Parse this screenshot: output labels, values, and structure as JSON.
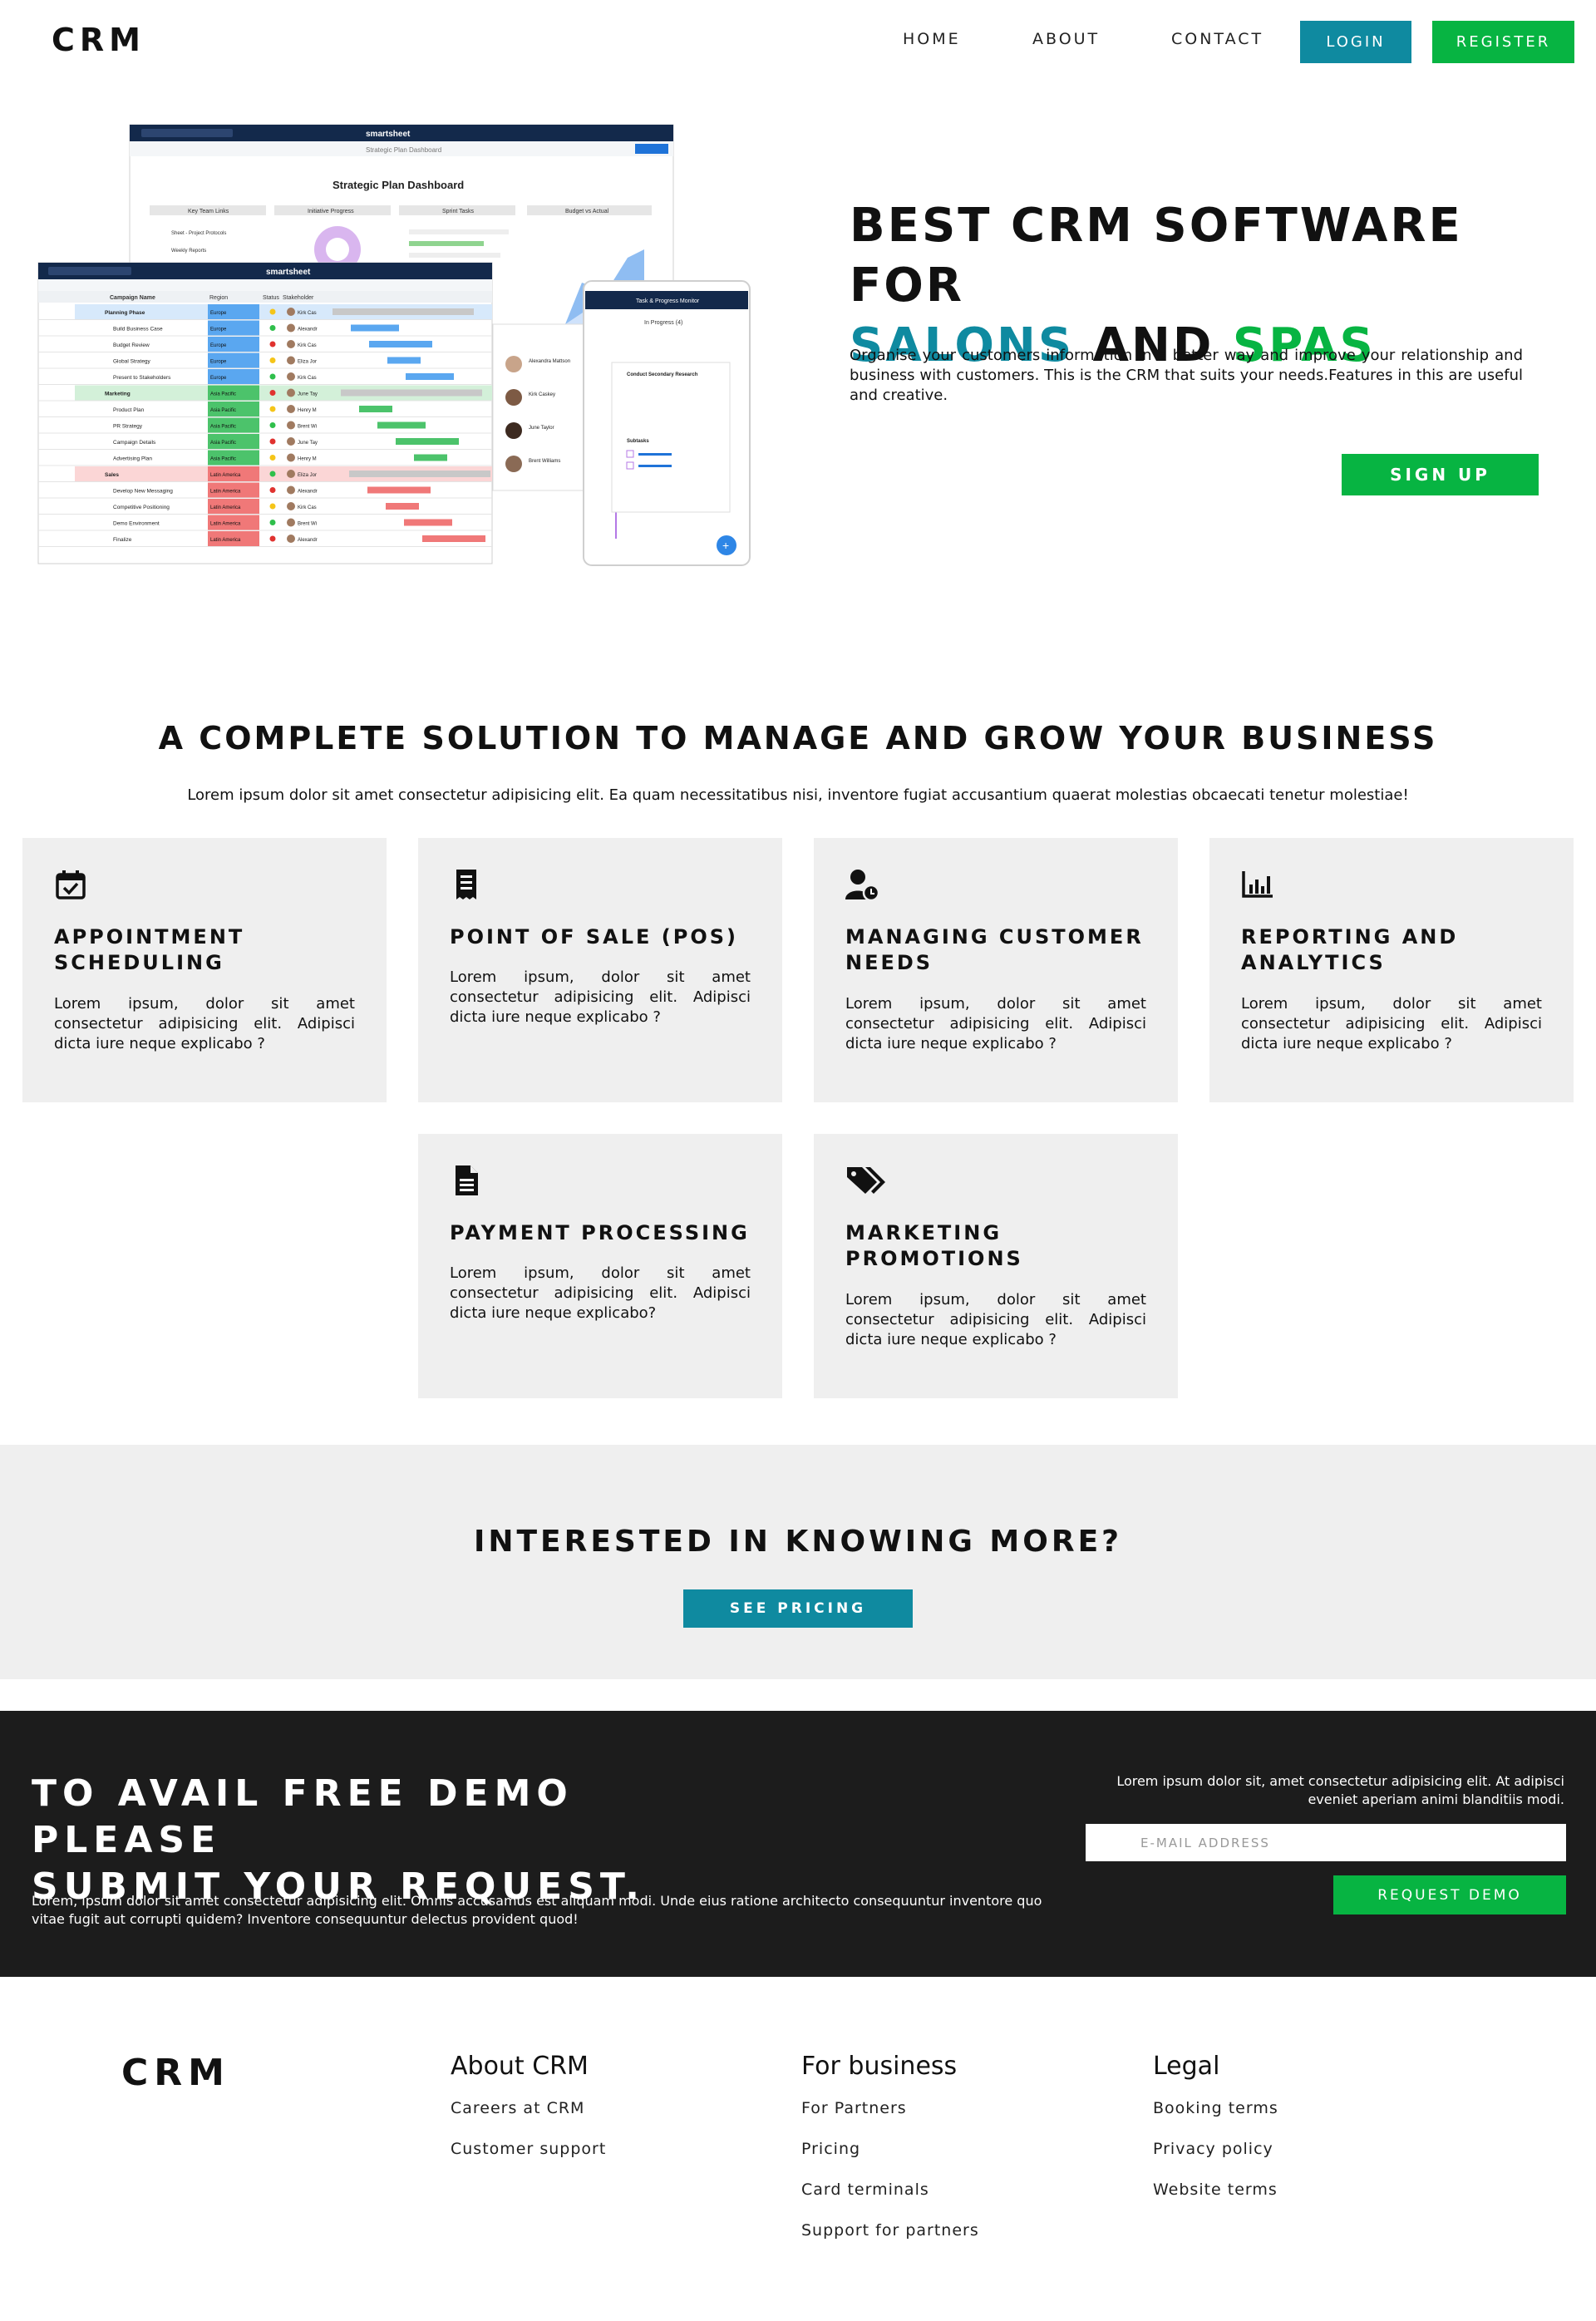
{
  "nav": {
    "logo": "CRM",
    "links": [
      "HOME",
      "ABOUT",
      "CONTACT"
    ],
    "login": "LOGIN",
    "register": "REGISTER"
  },
  "colors": {
    "teal": "#0f8aa0",
    "green": "#07b442",
    "dark": "#1c1c1c",
    "card": "#efefef"
  },
  "hero": {
    "title_line1": "BEST CRM SOFTWARE FOR",
    "title_teal": "SALONS",
    "title_and": "AND",
    "title_green": "SPAS",
    "description": "Organise your customers information in a better way and improve your relationship and business with customers. This is the CRM that suits your needs.Features in this are useful and creative.",
    "cta": "SIGN UP",
    "mockup": {
      "brand": "smartsheet",
      "dashboard_title": "Strategic Plan Dashboard",
      "sheet_tab": "Strategic Plan Dashboard",
      "panels": [
        "Key Team Links",
        "Initiative Progress",
        "Sprint Tasks",
        "Budget vs Actual"
      ],
      "links": [
        "Sheet - Project Protocols",
        "Weekly Reports"
      ],
      "grid_headers": [
        "Campaign Name",
        "Region",
        "Status",
        "Stakeholder"
      ],
      "rows": [
        {
          "name": "Planning Phase",
          "region": "Europe",
          "owner": "Kirk Cas"
        },
        {
          "name": "Build Business Case",
          "region": "Europe",
          "owner": "Alexandr"
        },
        {
          "name": "Budget Review",
          "region": "Europe",
          "owner": "Kirk Cas"
        },
        {
          "name": "Global Strategy",
          "region": "Europe",
          "owner": "Eliza Jor"
        },
        {
          "name": "Present to Stakeholders",
          "region": "Europe",
          "owner": "Kirk Cas"
        },
        {
          "name": "Marketing",
          "region": "Asia Pacific",
          "owner": "June Tay"
        },
        {
          "name": "Product Plan",
          "region": "Asia Pacific",
          "owner": "Henry M"
        },
        {
          "name": "PR Strategy",
          "region": "Asia Pacific",
          "owner": "Brent Wi"
        },
        {
          "name": "Campaign Details",
          "region": "Asia Pacific",
          "owner": "June Tay"
        },
        {
          "name": "Advertising Plan",
          "region": "Asia Pacific",
          "owner": "Henry M"
        },
        {
          "name": "Sales",
          "region": "Latin America",
          "owner": "Eliza Jor"
        },
        {
          "name": "Develop New Messaging",
          "region": "Latin America",
          "owner": "Alexandr"
        },
        {
          "name": "Competitive Positioning",
          "region": "Latin America",
          "owner": "Kirk Cas"
        },
        {
          "name": "Demo Environment",
          "region": "Latin America",
          "owner": "Brent Wi"
        },
        {
          "name": "Finalize",
          "region": "Latin America",
          "owner": "Alexandr"
        }
      ],
      "mobile_header": "Task & Progress Monitor",
      "mobile_tab": "In Progress (4)",
      "task_title": "Conduct Secondary Research",
      "task_subtasks": "Subtasks",
      "contacts": [
        "Alexandra Mattson",
        "Kirk Caskey",
        "June Taylor",
        "Brent Williams"
      ]
    }
  },
  "solution": {
    "title": "A COMPLETE SOLUTION TO MANAGE AND GROW YOUR BUSINESS",
    "subtitle": "Lorem ipsum dolor sit amet consectetur adipisicing elit. Ea quam necessitatibus nisi, inventore fugiat accusantium quaerat molestias obcaecati tenetur molestiae!",
    "cards": [
      {
        "icon": "calendar-check-icon",
        "title": "APPOINTMENT SCHEDULING",
        "text": "Lorem ipsum, dolor sit amet consectetur adipisicing elit. Adipisci dicta iure neque explicabo ?"
      },
      {
        "icon": "receipt-icon",
        "title": "POINT OF SALE (POS)",
        "text": "Lorem ipsum, dolor sit amet consectetur adipisicing elit. Adipisci dicta iure neque explicabo ?"
      },
      {
        "icon": "user-clock-icon",
        "title": "MANAGING CUSTOMER NEEDS",
        "text": "Lorem ipsum, dolor sit amet consectetur adipisicing elit. Adipisci dicta iure neque explicabo ?"
      },
      {
        "icon": "bar-chart-icon",
        "title": "REPORTING AND ANALYTICS",
        "text": "Lorem ipsum, dolor sit amet consectetur adipisicing elit. Adipisci dicta iure neque explicabo ?"
      },
      {
        "icon": "document-icon",
        "title": "PAYMENT PROCESSING",
        "text": "Lorem ipsum, dolor sit amet consectetur adipisicing elit. Adipisci dicta iure neque explicabo?"
      },
      {
        "icon": "tags-icon",
        "title": "MARKETING PROMOTIONS",
        "text": "Lorem ipsum, dolor sit amet consectetur adipisicing elit. Adipisci dicta iure neque explicabo ?"
      }
    ]
  },
  "interested": {
    "title": "INTERESTED IN KNOWING MORE?",
    "button": "SEE PRICING"
  },
  "demo": {
    "title_line1": "TO AVAIL FREE DEMO PLEASE",
    "title_line2": "SUBMIT YOUR REQUEST.",
    "description": "Lorem, ipsum dolor sit amet consectetur adipisicing elit. Omnis accusamus est aliquam modi. Unde eius ratione architecto consequuntur inventore quo vitae fugit aut corrupti quidem? Inventore consequuntur delectus provident quod!",
    "right_text": "Lorem ipsum dolor sit, amet consectetur adipisicing elit. At adipisci eveniet aperiam animi blanditiis modi.",
    "email_placeholder": "E-MAIL ADDRESS",
    "button": "REQUEST DEMO"
  },
  "footer": {
    "logo": "CRM",
    "columns": [
      {
        "title": "About CRM",
        "links": [
          "Careers at CRM",
          "Customer support"
        ]
      },
      {
        "title": "For business",
        "links": [
          "For Partners",
          "Pricing",
          "Card terminals",
          "Support for partners"
        ]
      },
      {
        "title": "Legal",
        "links": [
          "Booking terms",
          "Privacy policy",
          "Website terms"
        ]
      }
    ]
  }
}
